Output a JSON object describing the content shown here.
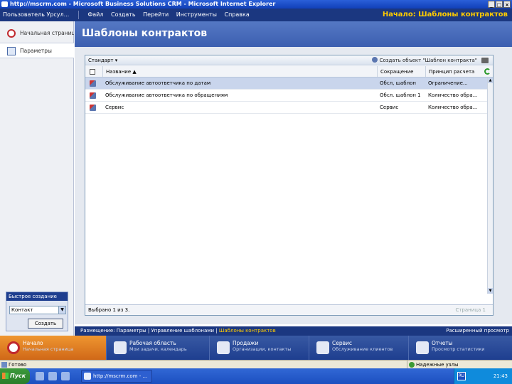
{
  "window": {
    "title": "http://mscrm.com - Microsoft Business Solutions CRM - Microsoft Internet Explorer",
    "buttons": [
      "_",
      "□",
      "×"
    ]
  },
  "menubar": {
    "user": "Пользователь Урсул...",
    "items": [
      "Файл",
      "Создать",
      "Перейти",
      "Инструменты",
      "Справка"
    ],
    "location": "Начало: Шаблоны контрактов"
  },
  "leftnav": {
    "items": [
      {
        "label": "Начальная страница",
        "icon": "crm-home-icon"
      },
      {
        "label": "Параметры",
        "icon": "settings-page-icon"
      }
    ]
  },
  "quick_create": {
    "title": "Быстрое создание",
    "select_value": "Контакт",
    "button": "Создать"
  },
  "page": {
    "title": "Шаблоны контрактов"
  },
  "grid": {
    "view_label": "Стандарт ▾",
    "new_button": "Создать объект \"Шаблон контракта\"",
    "columns": [
      "Название ▲",
      "Сокращение",
      "Принцип расчета"
    ],
    "rows": [
      {
        "name": "Обслуживание автоответчика по датам",
        "abbr": "Обсл, шаблон",
        "calc": "Ограничение...",
        "selected": true
      },
      {
        "name": "Обслуживание автоответчика по обращениям",
        "abbr": "Обсл. шаблон 1",
        "calc": "Количество обра..."
      },
      {
        "name": "Сервис",
        "abbr": "Сервис",
        "calc": "Количество обра..."
      }
    ],
    "footer_count": "Выбрано 1 из 3.",
    "footer_page": "Страница 1"
  },
  "crumbbar": {
    "prefix": "Размещение:",
    "path_1": "Параметры",
    "path_2": "Управление шаблонами",
    "current": "Шаблоны контрактов",
    "advanced": "Расширенный просмотр"
  },
  "bottomnav": [
    {
      "label": "Начало",
      "sub": "Начальная страница",
      "icon": "home-icon",
      "active": true
    },
    {
      "label": "Рабочая область",
      "sub": "Мои задачи, календарь",
      "icon": "workplace-icon"
    },
    {
      "label": "Продажи",
      "sub": "Организации, контакты",
      "icon": "sales-icon"
    },
    {
      "label": "Сервис",
      "sub": "Обслуживание клиентов",
      "icon": "service-icon"
    },
    {
      "label": "Отчеты",
      "sub": "Просмотр статистики",
      "icon": "reports-icon"
    }
  ],
  "statusbar": {
    "status": "Готово",
    "zone": "Надежные узлы"
  },
  "taskbar": {
    "start": "Пуск",
    "task": "http://mscrm.com - ...",
    "lang": "RU",
    "clock": "21:43"
  },
  "colors": {
    "nav_dark": "#1b3780",
    "accent_yellow": "#ffcc00",
    "header_blue": "#4a6cbc",
    "active_orange": "#e08428",
    "selected_row": "#c9d5ec"
  }
}
